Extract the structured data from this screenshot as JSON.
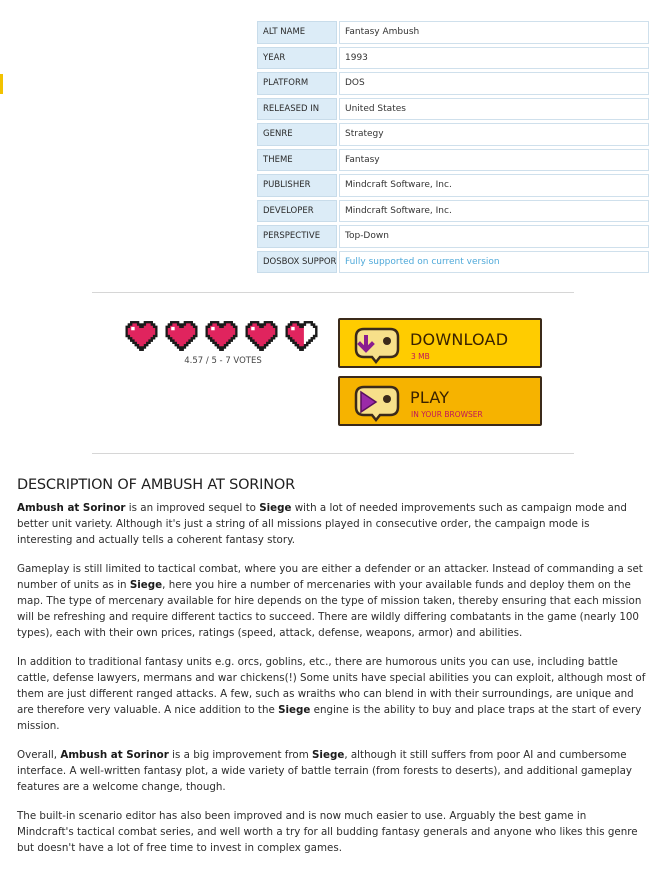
{
  "info": [
    {
      "key": "ALT NAME",
      "value": "Fantasy Ambush"
    },
    {
      "key": "YEAR",
      "value": "1993"
    },
    {
      "key": "PLATFORM",
      "value": "DOS"
    },
    {
      "key": "RELEASED IN",
      "value": "United States"
    },
    {
      "key": "GENRE",
      "value": "Strategy"
    },
    {
      "key": "THEME",
      "value": "Fantasy"
    },
    {
      "key": "PUBLISHER",
      "value": "Mindcraft Software, Inc."
    },
    {
      "key": "DEVELOPER",
      "value": "Mindcraft Software, Inc."
    },
    {
      "key": "PERSPECTIVE",
      "value": "Top-Down"
    },
    {
      "key": "DOSBOX SUPPORT",
      "value": "Fully supported on current version"
    }
  ],
  "rating": {
    "score_fraction": 0.914,
    "hearts_filled": 4.57,
    "hearts_total": 5,
    "votes_text": "4.57 / 5 - 7 VOTES"
  },
  "download": {
    "label": "DOWNLOAD",
    "sublabel": "3 MB",
    "icon": "download-arrow-icon"
  },
  "play": {
    "label": "PLAY",
    "sublabel": "IN YOUR BROWSER",
    "icon": "play-triangle-icon"
  },
  "colors": {
    "heart": "#e0245e",
    "button_download": "#ffcc00",
    "button_play": "#f6b300",
    "accent_link": "#4fa9d9",
    "table_key_bg": "#dcecf7"
  },
  "description": {
    "title": "DESCRIPTION OF AMBUSH AT SORINOR",
    "p1": [
      {
        "b": "Ambush at Sorinor"
      },
      {
        "t": " is an improved sequel to "
      },
      {
        "b": "Siege"
      },
      {
        "t": " with a lot of needed improvements such as campaign mode and better unit variety. Although it's just a string of all missions played in consecutive order, the campaign mode is interesting and actually tells a coherent fantasy story."
      }
    ],
    "p2": [
      {
        "t": "Gameplay is still limited to tactical combat, where you are either a defender or an attacker. Instead of commanding a set number of units as in "
      },
      {
        "b": "Siege"
      },
      {
        "t": ", here you hire a number of mercenaries with your available funds and deploy them on the map. The type of mercenary available for hire depends on the type of mission taken, thereby ensuring that each mission will be refreshing and require different tactics to succeed. There are wildly differing combatants in the game (nearly 100 types), each with their own prices, ratings (speed, attack, defense, weapons, armor) and abilities."
      }
    ],
    "p3": [
      {
        "t": "In addition to traditional fantasy units e.g. orcs, goblins, etc., there are humorous units you can use, including battle cattle, defense lawyers, mermans and war chickens(!) Some units have special abilities you can exploit, although most of them are just different ranged attacks. A few, such as wraiths who can blend in with their surroundings, are unique and are therefore very valuable. A nice addition to the "
      },
      {
        "b": "Siege"
      },
      {
        "t": " engine is the ability to buy and place traps at the start of every mission."
      }
    ],
    "p4": [
      {
        "t": "Overall, "
      },
      {
        "b": "Ambush at Sorinor"
      },
      {
        "t": " is a big improvement from "
      },
      {
        "b": "Siege"
      },
      {
        "t": ", although it still suffers from poor AI and cumbersome interface. A well-written fantasy plot, a wide variety of battle terrain (from forests to deserts), and additional gameplay features are a welcome change, though."
      }
    ],
    "p5": [
      {
        "t": "The built-in scenario editor has also been improved and is now much easier to use. Arguably the best game in Mindcraft's tactical combat series, and well worth a try for all budding fantasy generals and anyone who likes this genre but doesn't have a lot of free time to invest in complex games."
      }
    ]
  }
}
